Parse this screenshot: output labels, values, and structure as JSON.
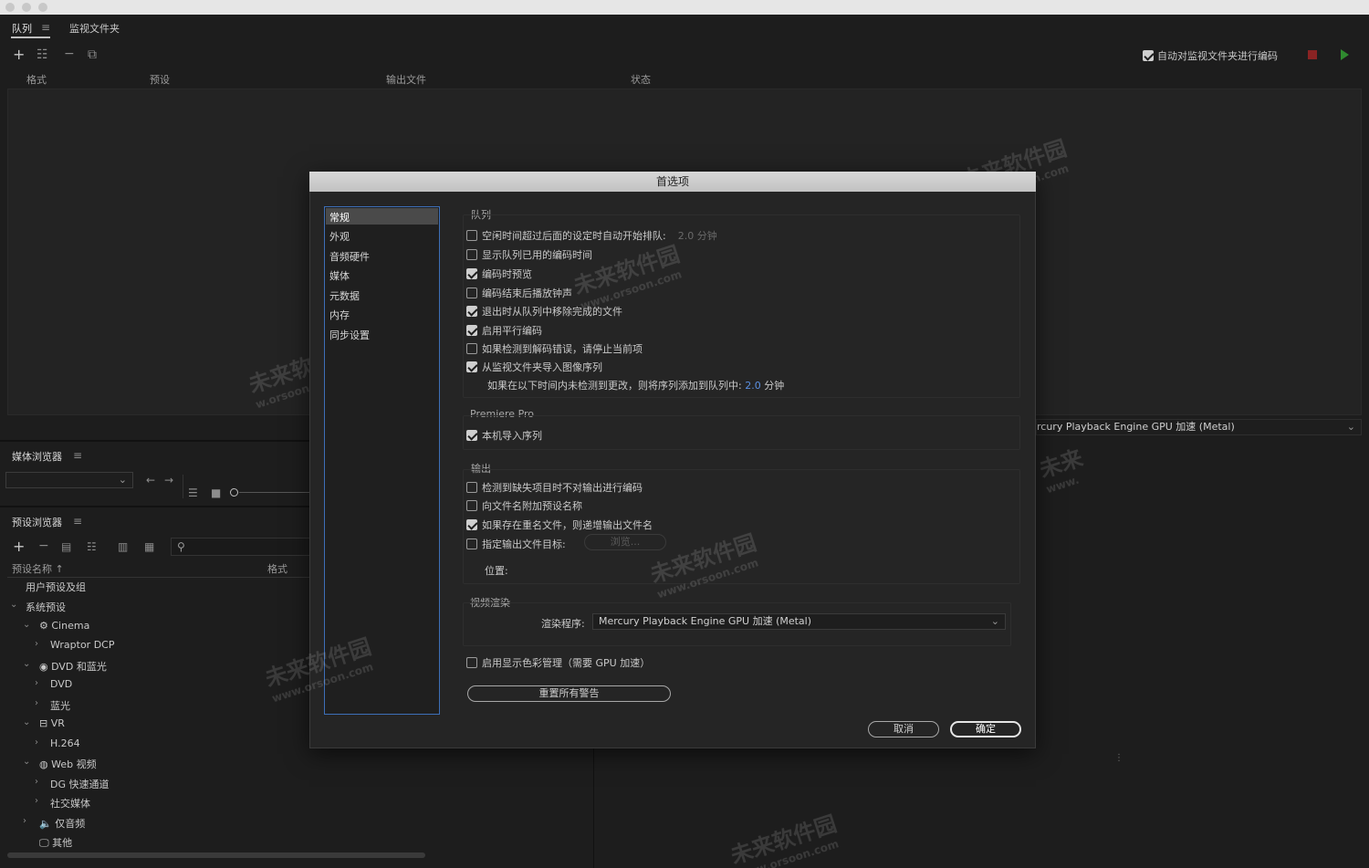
{
  "window": {
    "tabs": [
      {
        "label": "队列"
      },
      {
        "label": "监视文件夹"
      }
    ],
    "auto_encode_label": "自动对监视文件夹进行编码",
    "queue_columns": [
      "格式",
      "预设",
      "输出文件",
      "状态"
    ]
  },
  "media_browser": {
    "title": "媒体浏览器"
  },
  "preset_browser": {
    "title": "预设浏览器",
    "col_name": "预设名称",
    "col_format": "格式",
    "tree": [
      {
        "label": "用户预设及组"
      },
      {
        "label": "系统预设"
      },
      {
        "label": "Cinema",
        "icon": "cinema-icon"
      },
      {
        "label": "Wraptor DCP"
      },
      {
        "label": "DVD 和蓝光",
        "icon": "disc-icon"
      },
      {
        "label": "DVD"
      },
      {
        "label": "蓝光"
      },
      {
        "label": "VR",
        "icon": "vr-headset-icon"
      },
      {
        "label": "H.264"
      },
      {
        "label": "Web 视频",
        "icon": "globe-icon"
      },
      {
        "label": "DG 快速通道"
      },
      {
        "label": "社交媒体"
      },
      {
        "label": "仅音频",
        "icon": "speaker-icon"
      },
      {
        "label": "其他",
        "icon": "monitor-icon"
      }
    ]
  },
  "renderer_bar": {
    "label": "rcury Playback Engine GPU 加速 (Metal)"
  },
  "dialog": {
    "title": "首选项",
    "sidebar": [
      "常规",
      "外观",
      "音频硬件",
      "媒体",
      "元数据",
      "内存",
      "同步设置"
    ],
    "queue_section": {
      "title": "队列",
      "items": [
        {
          "label": "空闲时间超过后面的设定时自动开始排队:",
          "checked": false,
          "extra": "2.0 分钟"
        },
        {
          "label": "显示队列已用的编码时间",
          "checked": false
        },
        {
          "label": "编码时预览",
          "checked": true
        },
        {
          "label": "编码结束后播放钟声",
          "checked": false
        },
        {
          "label": "退出时从队列中移除完成的文件",
          "checked": true
        },
        {
          "label": "启用平行编码",
          "checked": true
        },
        {
          "label": "如果检测到解码错误，请停止当前项",
          "checked": false
        },
        {
          "label": "从监视文件夹导入图像序列",
          "checked": true
        }
      ],
      "note_prefix": "如果在以下时间内未检测到更改，则将序列添加到队列中:",
      "note_value": "2.0",
      "note_unit": "分钟"
    },
    "premiere_section": {
      "title": "Premiere Pro",
      "items": [
        {
          "label": "本机导入序列",
          "checked": true
        }
      ]
    },
    "output_section": {
      "title": "输出",
      "items": [
        {
          "label": "检测到缺失项目时不对输出进行编码",
          "checked": false
        },
        {
          "label": "向文件名附加预设名称",
          "checked": false
        },
        {
          "label": "如果存在重名文件，则递增输出文件名",
          "checked": true
        },
        {
          "label": "指定输出文件目标:",
          "checked": false
        }
      ],
      "browse_label": "浏览...",
      "location_label": "位置:"
    },
    "render_section": {
      "title": "视频渲染",
      "renderer_label": "渲染程序:",
      "renderer_value": "Mercury Playback Engine GPU 加速 (Metal)"
    },
    "color_mgmt": {
      "label": "启用显示色彩管理（需要 GPU 加速）",
      "checked": false
    },
    "reset_warnings": "重置所有警告",
    "cancel": "取消",
    "ok": "确定"
  },
  "watermark": {
    "brand": "未来软件园",
    "url": "www.orsoon.com",
    "url_partial_left": "w.orsoon.com",
    "brand_partial_right": "未来",
    "url_partial_right": "www."
  },
  "colors": {
    "accent": "#3d6fb8",
    "link_value": "#5a8fe0",
    "stop_red": "#8a2323",
    "play_green": "#2f8a2f"
  }
}
